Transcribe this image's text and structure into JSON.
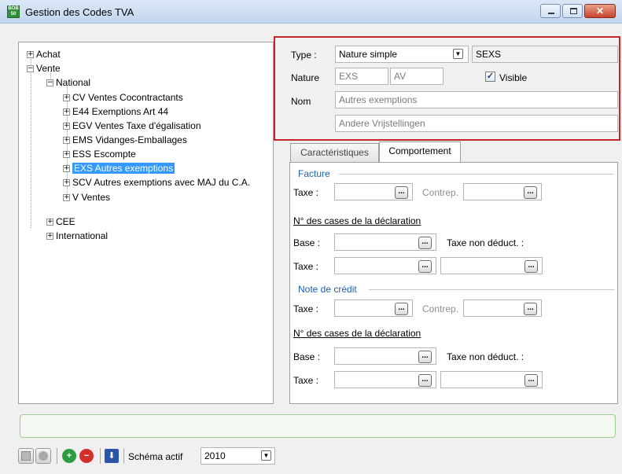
{
  "window": {
    "title": "Gestion des Codes TVA",
    "app_icon_text": "BOB 50"
  },
  "tree": {
    "items": [
      {
        "label": "Achat",
        "expander": "+"
      },
      {
        "label": "Vente",
        "expander": "−"
      },
      {
        "label": "National",
        "expander": "−"
      },
      {
        "label": "CV Ventes Cocontractants",
        "expander": "+"
      },
      {
        "label": "E44 Exemptions Art 44",
        "expander": "+"
      },
      {
        "label": "EGV Ventes Taxe d'égalisation",
        "expander": "+"
      },
      {
        "label": "EMS Vidanges-Emballages",
        "expander": "+"
      },
      {
        "label": "ESS Escompte",
        "expander": "+"
      },
      {
        "label": "EXS Autres exemptions",
        "expander": "+"
      },
      {
        "label": "SCV Autres exemptions avec MAJ du C.A.",
        "expander": "+"
      },
      {
        "label": "V Ventes",
        "expander": "+"
      },
      {
        "label": "CEE",
        "expander": "+"
      },
      {
        "label": "International",
        "expander": "+"
      }
    ]
  },
  "header": {
    "type_label": "Type :",
    "type_value": "Nature simple",
    "type_code": "SEXS",
    "nature_label": "Nature",
    "nature_code1": "EXS",
    "nature_code2": "AV",
    "visible_label": "Visible",
    "nom_label": "Nom",
    "nom_fr": "Autres exemptions",
    "nom_nl": "Andere Vrijstellingen"
  },
  "tabs": [
    {
      "label": "Caractéristiques",
      "active": false
    },
    {
      "label": "Comportement",
      "active": true
    }
  ],
  "comportement": {
    "facture": {
      "group_title": "Facture",
      "taxe_label": "Taxe :",
      "contrep_label": "Contrep.",
      "cases_title": "N° des cases de la déclaration",
      "base_label": "Base :",
      "taxe_non_deduct_label": "Taxe non déduct. :",
      "taxe2_label": "Taxe :"
    },
    "note_credit": {
      "group_title": "Note de crédit",
      "taxe_label": "Taxe :",
      "contrep_label": "Contrep.",
      "cases_title": "N° des cases de la déclaration",
      "base_label": "Base :",
      "taxe_non_deduct_label": "Taxe non déduct. :",
      "taxe2_label": "Taxe :"
    },
    "browse_glyph": "..."
  },
  "toolbar": {
    "schema_label": "Schéma actif",
    "schema_value": "2010"
  }
}
